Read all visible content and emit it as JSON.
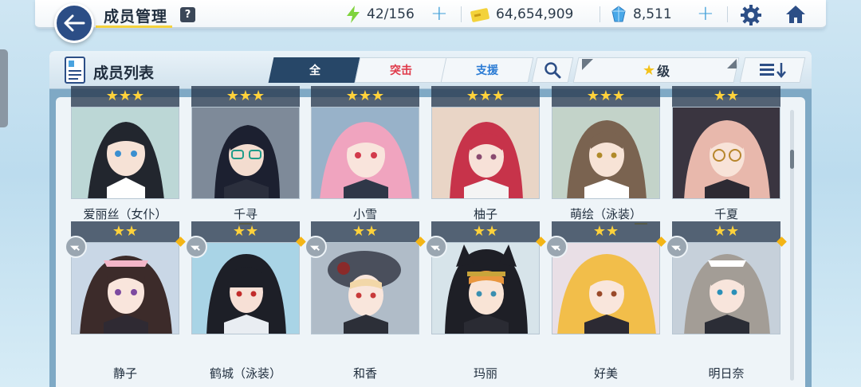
{
  "header": {
    "title": "成员管理",
    "help": "?",
    "ap": "42/156",
    "credits": "64,654,909",
    "gems": "8,511"
  },
  "panel": {
    "title": "成员列表",
    "tabs": [
      "全",
      "突击",
      "支援"
    ],
    "sort_label": "级",
    "sort_star": "★"
  },
  "colors": {
    "accent": "#274768",
    "assault": "#e03a4a",
    "support": "#2a7bd4",
    "star": "#ffd23b",
    "highlight": "#f4d23c"
  },
  "icons": [
    "back-arrow-icon",
    "lightning-icon",
    "credit-card-icon",
    "gem-icon",
    "gear-icon",
    "home-icon",
    "list-doc-icon",
    "search-icon",
    "sort-order-icon",
    "lock-pin-icon",
    "star-icon"
  ],
  "members_row1": [
    {
      "name": "爱丽丝（女仆）",
      "stars": "★★★"
    },
    {
      "name": "千寻",
      "stars": "★★★"
    },
    {
      "name": "小雪",
      "stars": "★★★"
    },
    {
      "name": "柚子",
      "stars": "★★★"
    },
    {
      "name": "萌绘（泳装）",
      "stars": "★★★"
    },
    {
      "name": "千夏",
      "stars": "★★"
    }
  ],
  "members_row2": [
    {
      "name": "静子",
      "stars": "★★"
    },
    {
      "name": "鹤城（泳装）",
      "stars": "★★"
    },
    {
      "name": "和香",
      "stars": "★★"
    },
    {
      "name": "玛丽",
      "stars": "★★"
    },
    {
      "name": "好美",
      "stars": "★★"
    },
    {
      "name": "明日奈",
      "stars": "★★"
    }
  ]
}
